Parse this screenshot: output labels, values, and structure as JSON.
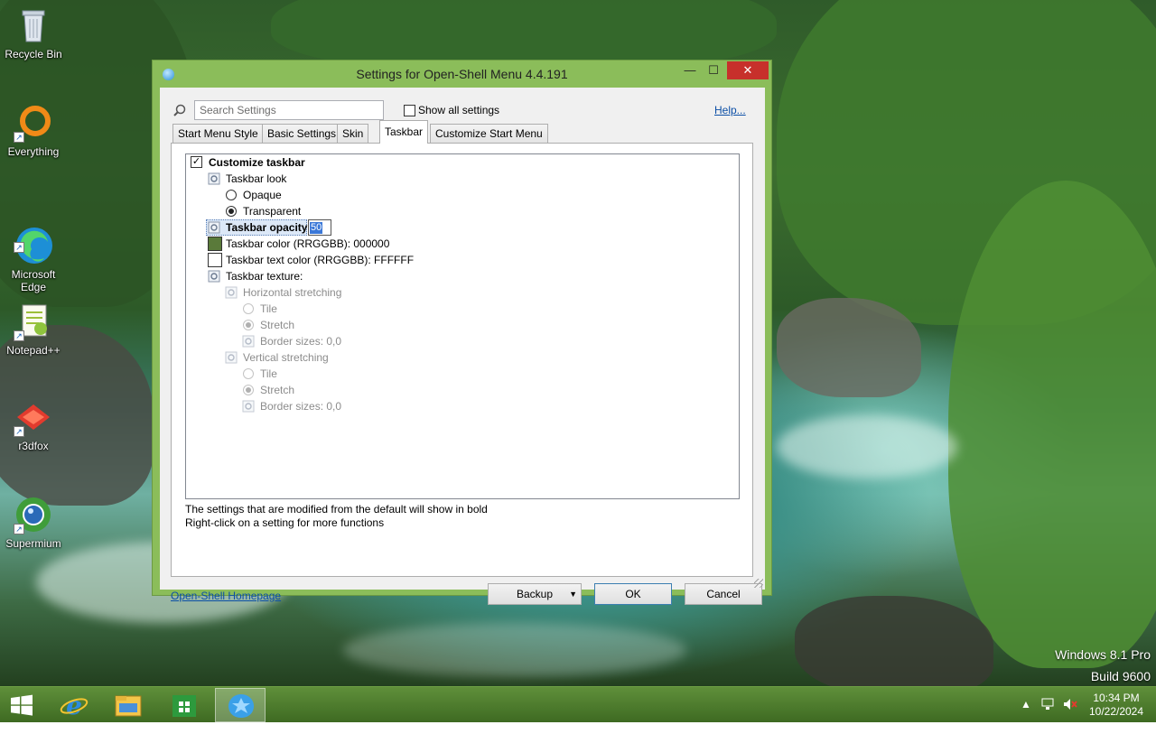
{
  "desktop": {
    "icons": [
      {
        "label": "Recycle Bin"
      },
      {
        "label": "Everything"
      },
      {
        "label": "Microsoft\nEdge"
      },
      {
        "label": "Notepad++"
      },
      {
        "label": "r3dfox"
      },
      {
        "label": "Supermium"
      }
    ],
    "watermark": {
      "line1": "Windows 8.1 Pro",
      "line2": "Build 9600"
    }
  },
  "window": {
    "title": "Settings for Open-Shell Menu 4.4.191",
    "controls": {
      "minimize": "—",
      "maximize": "☐",
      "close": "✕"
    },
    "search": {
      "placeholder": "Search Settings",
      "value": ""
    },
    "show_all": {
      "label": "Show all settings",
      "checked": false
    },
    "help_label": "Help...",
    "tabs": [
      {
        "label": "Start Menu Style",
        "active": false
      },
      {
        "label": "Basic Settings",
        "active": false
      },
      {
        "label": "Skin",
        "active": false
      },
      {
        "label": "Taskbar",
        "active": true
      },
      {
        "label": "Customize Start Menu",
        "active": false
      }
    ],
    "tree": {
      "customize_taskbar": {
        "label": "Customize taskbar",
        "checked": true
      },
      "taskbar_look": {
        "label": "Taskbar look"
      },
      "opaque": {
        "label": "Opaque",
        "selected": false
      },
      "transparent": {
        "label": "Transparent",
        "selected": true
      },
      "taskbar_opacity": {
        "label": "Taskbar opacity",
        "value": "50"
      },
      "taskbar_color": {
        "label": "Taskbar color (RRGGBB): 000000",
        "swatch": "#5a7a3a"
      },
      "taskbar_text_color": {
        "label": "Taskbar text color (RRGGBB): FFFFFF",
        "swatch": "#ffffff"
      },
      "taskbar_texture": {
        "label": "Taskbar texture:"
      },
      "horizontal_stretching": {
        "label": "Horizontal stretching"
      },
      "h_tile": {
        "label": "Tile"
      },
      "h_stretch": {
        "label": "Stretch"
      },
      "h_border": {
        "label": "Border sizes: 0,0"
      },
      "vertical_stretching": {
        "label": "Vertical stretching"
      },
      "v_tile": {
        "label": "Tile"
      },
      "v_stretch": {
        "label": "Stretch"
      },
      "v_border": {
        "label": "Border sizes: 0,0"
      }
    },
    "info": {
      "line1": "The settings that are modified from the default will show in bold",
      "line2": "Right-click on a setting for more functions"
    },
    "homepage_label": "Open-Shell Homepage",
    "buttons": {
      "backup": "Backup",
      "ok": "OK",
      "cancel": "Cancel"
    }
  },
  "taskbar": {
    "clock": {
      "time": "10:34 PM",
      "date": "10/22/2024"
    },
    "tray_chevron": "▲"
  },
  "colors": {
    "window_frame": "#8bbd5a",
    "close_button": "#c7302b",
    "link": "#0b4fa6",
    "taskbar": "#4d7c2d"
  }
}
